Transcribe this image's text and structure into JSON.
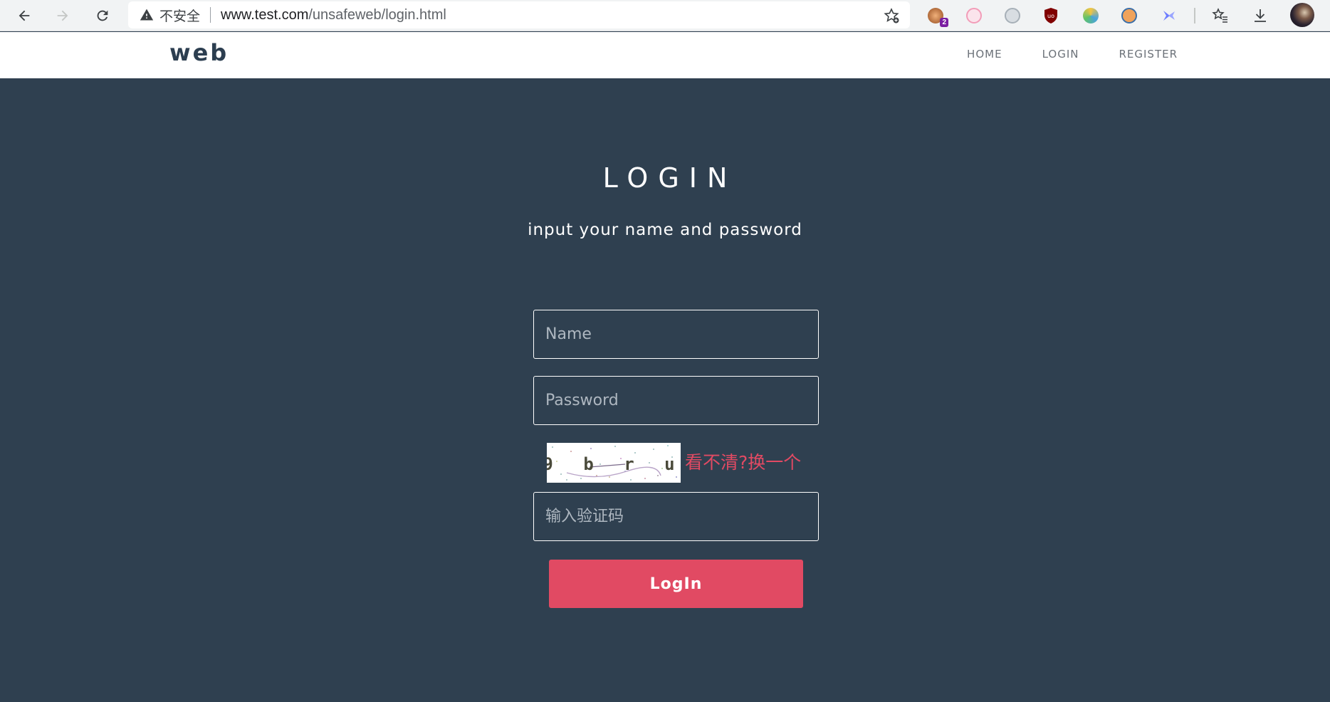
{
  "browser": {
    "insecure_label": "不安全",
    "url_host": "www.test.com",
    "url_path": "/unsafeweb/login.html",
    "extension_badge": "2"
  },
  "site": {
    "brand": "web",
    "menu": [
      {
        "label": "HOME"
      },
      {
        "label": "LOGIN"
      },
      {
        "label": "REGISTER"
      }
    ]
  },
  "login": {
    "title": "LOGIN",
    "subtitle": "input your name and password",
    "name_placeholder": "Name",
    "password_placeholder": "Password",
    "captcha_refresh": "看不清?换一个",
    "captcha_text": "9 b r u",
    "code_placeholder": "输入验证码",
    "submit_label": "LogIn"
  },
  "colors": {
    "background": "#2f4050",
    "accent": "#e14a63",
    "brand": "#2c3e50"
  }
}
